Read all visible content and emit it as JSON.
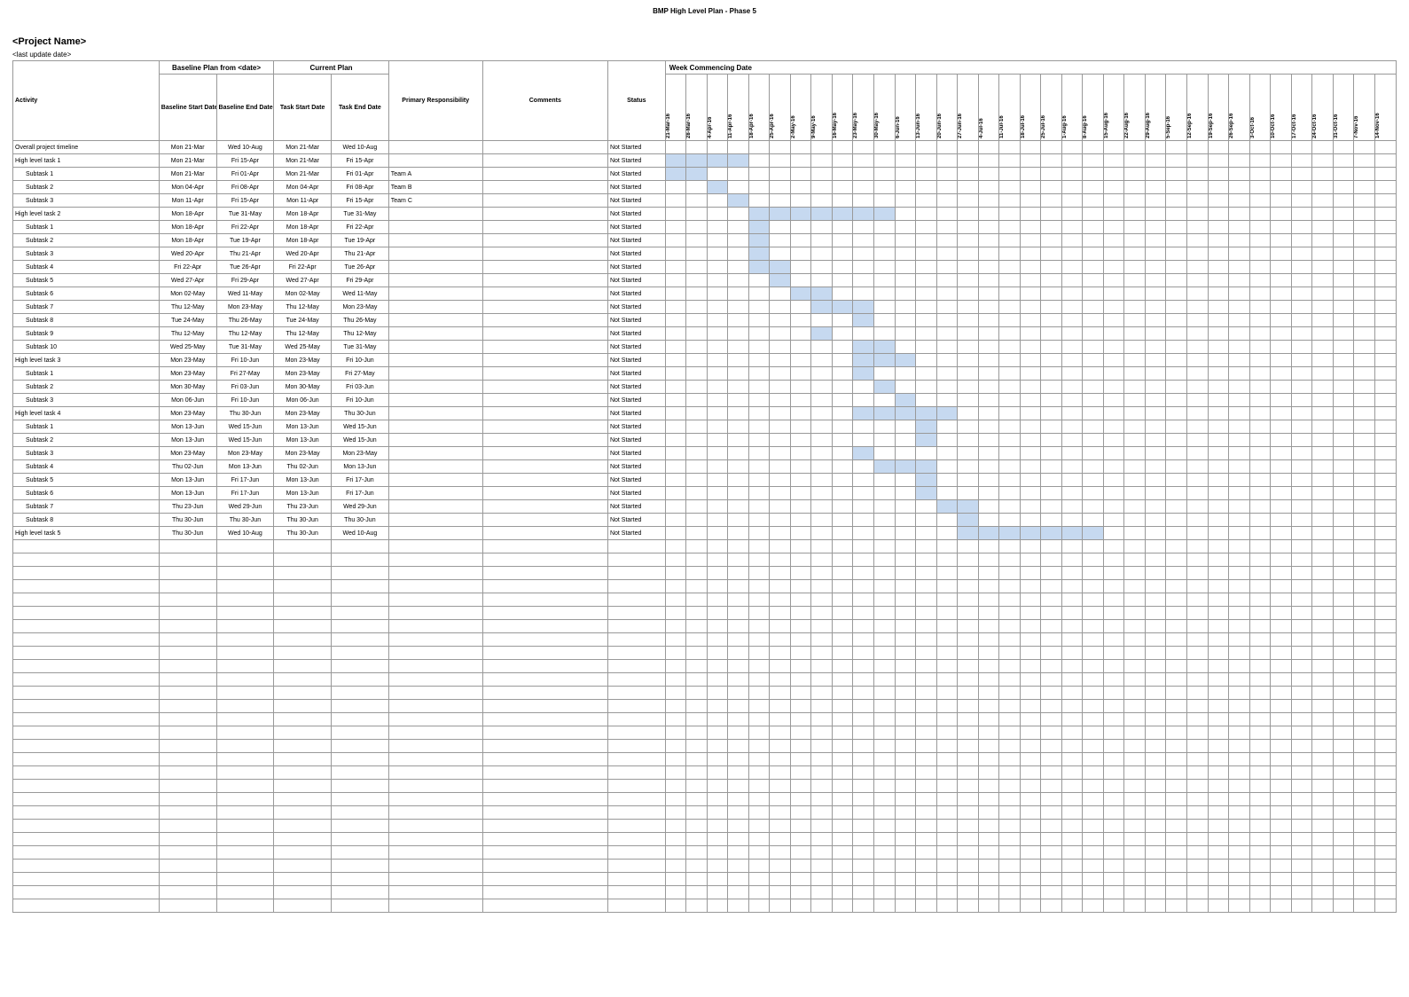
{
  "doc_title_top": "BMP High Level Plan - Phase 5",
  "project_name": "<Project Name>",
  "last_update": "<last update date>",
  "super_headers": {
    "baseline": "Baseline Plan\nfrom <date>",
    "current": "Current Plan",
    "weeks": "Week Commencing Date"
  },
  "headers": {
    "activity": "Activity",
    "bl_start": "Baseline Start Date",
    "bl_end": "Baseline End Date",
    "task_start": "Task Start Date",
    "task_end": "Task End Date",
    "resp": "Primary Responsibility",
    "comments": "Comments",
    "status": "Status"
  },
  "week_labels": [
    "21-Mar-16",
    "28-Mar-16",
    "4-Apr-16",
    "11-Apr-16",
    "18-Apr-16",
    "25-Apr-16",
    "2-May-16",
    "9-May-16",
    "16-May-16",
    "23-May-16",
    "30-May-16",
    "6-Jun-16",
    "13-Jun-16",
    "20-Jun-16",
    "27-Jun-16",
    "4-Jul-16",
    "11-Jul-16",
    "18-Jul-16",
    "25-Jul-16",
    "1-Aug-16",
    "8-Aug-16",
    "15-Aug-16",
    "22-Aug-16",
    "29-Aug-16",
    "5-Sep-16",
    "12-Sep-16",
    "19-Sep-16",
    "26-Sep-16",
    "3-Oct-16",
    "10-Oct-16",
    "17-Oct-16",
    "24-Oct-16",
    "31-Oct-16",
    "7-Nov-16",
    "14-Nov-16"
  ],
  "rows": [
    {
      "a": "Overall project timeline",
      "i": 0,
      "bs": "Mon 21-Mar",
      "be": "Wed 10-Aug",
      "ts": "Mon 21-Mar",
      "te": "Wed 10-Aug",
      "r": "",
      "s": "Not Started",
      "bar": []
    },
    {
      "a": "High level task 1",
      "i": 0,
      "bs": "Mon 21-Mar",
      "be": "Fri 15-Apr",
      "ts": "Mon 21-Mar",
      "te": "Fri 15-Apr",
      "r": "",
      "s": "Not Started",
      "bar": [
        0,
        1,
        2,
        3
      ]
    },
    {
      "a": "Subtask 1",
      "i": 2,
      "bs": "Mon 21-Mar",
      "be": "Fri 01-Apr",
      "ts": "Mon 21-Mar",
      "te": "Fri 01-Apr",
      "r": "Team A",
      "s": "Not Started",
      "bar": [
        0,
        1
      ]
    },
    {
      "a": "Subtask 2",
      "i": 2,
      "bs": "Mon 04-Apr",
      "be": "Fri 08-Apr",
      "ts": "Mon 04-Apr",
      "te": "Fri 08-Apr",
      "r": "Team B",
      "s": "Not Started",
      "bar": [
        2
      ]
    },
    {
      "a": "Subtask 3",
      "i": 2,
      "bs": "Mon 11-Apr",
      "be": "Fri 15-Apr",
      "ts": "Mon 11-Apr",
      "te": "Fri 15-Apr",
      "r": "Team C",
      "s": "Not Started",
      "bar": [
        3
      ]
    },
    {
      "a": "High level task 2",
      "i": 0,
      "bs": "Mon 18-Apr",
      "be": "Tue 31-May",
      "ts": "Mon 18-Apr",
      "te": "Tue 31-May",
      "r": "",
      "s": "Not Started",
      "bar": [
        4,
        5,
        6,
        7,
        8,
        9,
        10
      ]
    },
    {
      "a": "Subtask 1",
      "i": 2,
      "bs": "Mon 18-Apr",
      "be": "Fri 22-Apr",
      "ts": "Mon 18-Apr",
      "te": "Fri 22-Apr",
      "r": "",
      "s": "Not Started",
      "bar": [
        4
      ]
    },
    {
      "a": "Subtask 2",
      "i": 2,
      "bs": "Mon 18-Apr",
      "be": "Tue 19-Apr",
      "ts": "Mon 18-Apr",
      "te": "Tue 19-Apr",
      "r": "",
      "s": "Not Started",
      "bar": [
        4
      ]
    },
    {
      "a": "Subtask 3",
      "i": 2,
      "bs": "Wed 20-Apr",
      "be": "Thu 21-Apr",
      "ts": "Wed 20-Apr",
      "te": "Thu 21-Apr",
      "r": "",
      "s": "Not Started",
      "bar": [
        4
      ]
    },
    {
      "a": "Subtask 4",
      "i": 2,
      "bs": "Fri 22-Apr",
      "be": "Tue 26-Apr",
      "ts": "Fri 22-Apr",
      "te": "Tue 26-Apr",
      "r": "",
      "s": "Not Started",
      "bar": [
        4,
        5
      ]
    },
    {
      "a": "Subtask 5",
      "i": 2,
      "bs": "Wed 27-Apr",
      "be": "Fri 29-Apr",
      "ts": "Wed 27-Apr",
      "te": "Fri 29-Apr",
      "r": "",
      "s": "Not Started",
      "bar": [
        5
      ]
    },
    {
      "a": "Subtask 6",
      "i": 2,
      "bs": "Mon 02-May",
      "be": "Wed 11-May",
      "ts": "Mon 02-May",
      "te": "Wed 11-May",
      "r": "",
      "s": "Not Started",
      "bar": [
        6,
        7
      ]
    },
    {
      "a": "Subtask 7",
      "i": 2,
      "bs": "Thu 12-May",
      "be": "Mon 23-May",
      "ts": "Thu 12-May",
      "te": "Mon 23-May",
      "r": "",
      "s": "Not Started",
      "bar": [
        7,
        8,
        9
      ]
    },
    {
      "a": "Subtask 8",
      "i": 2,
      "bs": "Tue 24-May",
      "be": "Thu 26-May",
      "ts": "Tue 24-May",
      "te": "Thu 26-May",
      "r": "",
      "s": "Not Started",
      "bar": [
        9
      ]
    },
    {
      "a": "Subtask 9",
      "i": 2,
      "bs": "Thu 12-May",
      "be": "Thu 12-May",
      "ts": "Thu 12-May",
      "te": "Thu 12-May",
      "r": "",
      "s": "Not Started",
      "bar": [
        7
      ]
    },
    {
      "a": "Subtask 10",
      "i": 2,
      "bs": "Wed 25-May",
      "be": "Tue 31-May",
      "ts": "Wed 25-May",
      "te": "Tue 31-May",
      "r": "",
      "s": "Not Started",
      "bar": [
        9,
        10
      ]
    },
    {
      "a": "High level task 3",
      "i": 0,
      "bs": "Mon 23-May",
      "be": "Fri 10-Jun",
      "ts": "Mon 23-May",
      "te": "Fri 10-Jun",
      "r": "",
      "s": "Not Started",
      "bar": [
        9,
        10,
        11
      ]
    },
    {
      "a": "Subtask 1",
      "i": 2,
      "bs": "Mon 23-May",
      "be": "Fri 27-May",
      "ts": "Mon 23-May",
      "te": "Fri 27-May",
      "r": "",
      "s": "Not Started",
      "bar": [
        9
      ]
    },
    {
      "a": "Subtask 2",
      "i": 2,
      "bs": "Mon 30-May",
      "be": "Fri 03-Jun",
      "ts": "Mon 30-May",
      "te": "Fri 03-Jun",
      "r": "",
      "s": "Not Started",
      "bar": [
        10
      ]
    },
    {
      "a": "Subtask 3",
      "i": 2,
      "bs": "Mon 06-Jun",
      "be": "Fri 10-Jun",
      "ts": "Mon 06-Jun",
      "te": "Fri 10-Jun",
      "r": "",
      "s": "Not Started",
      "bar": [
        11
      ]
    },
    {
      "a": "High level task 4",
      "i": 0,
      "bs": "Mon 23-May",
      "be": "Thu 30-Jun",
      "ts": "Mon 23-May",
      "te": "Thu 30-Jun",
      "r": "",
      "s": "Not Started",
      "bar": [
        9,
        10,
        11,
        12,
        13
      ]
    },
    {
      "a": "Subtask 1",
      "i": 2,
      "bs": "Mon 13-Jun",
      "be": "Wed 15-Jun",
      "ts": "Mon 13-Jun",
      "te": "Wed 15-Jun",
      "r": "",
      "s": "Not Started",
      "bar": [
        12
      ]
    },
    {
      "a": "Subtask 2",
      "i": 2,
      "bs": "Mon 13-Jun",
      "be": "Wed 15-Jun",
      "ts": "Mon 13-Jun",
      "te": "Wed 15-Jun",
      "r": "",
      "s": "Not Started",
      "bar": [
        12
      ]
    },
    {
      "a": "Subtask 3",
      "i": 2,
      "bs": "Mon 23-May",
      "be": "Mon 23-May",
      "ts": "Mon 23-May",
      "te": "Mon 23-May",
      "r": "",
      "s": "Not Started",
      "bar": [
        9
      ]
    },
    {
      "a": "Subtask 4",
      "i": 2,
      "bs": "Thu 02-Jun",
      "be": "Mon 13-Jun",
      "ts": "Thu 02-Jun",
      "te": "Mon 13-Jun",
      "r": "",
      "s": "Not Started",
      "bar": [
        10,
        11,
        12
      ]
    },
    {
      "a": "Subtask 5",
      "i": 2,
      "bs": "Mon 13-Jun",
      "be": "Fri 17-Jun",
      "ts": "Mon 13-Jun",
      "te": "Fri 17-Jun",
      "r": "",
      "s": "Not Started",
      "bar": [
        12
      ]
    },
    {
      "a": "Subtask 6",
      "i": 2,
      "bs": "Mon 13-Jun",
      "be": "Fri 17-Jun",
      "ts": "Mon 13-Jun",
      "te": "Fri 17-Jun",
      "r": "",
      "s": "Not Started",
      "bar": [
        12
      ]
    },
    {
      "a": "Subtask 7",
      "i": 2,
      "bs": "Thu 23-Jun",
      "be": "Wed 29-Jun",
      "ts": "Thu 23-Jun",
      "te": "Wed 29-Jun",
      "r": "",
      "s": "Not Started",
      "bar": [
        13,
        14
      ]
    },
    {
      "a": "Subtask 8",
      "i": 2,
      "bs": "Thu 30-Jun",
      "be": "Thu 30-Jun",
      "ts": "Thu 30-Jun",
      "te": "Thu 30-Jun",
      "r": "",
      "s": "Not Started",
      "bar": [
        14
      ]
    },
    {
      "a": "High level task 5",
      "i": 0,
      "bs": "Thu 30-Jun",
      "be": "Wed 10-Aug",
      "ts": "Thu 30-Jun",
      "te": "Wed 10-Aug",
      "r": "",
      "s": "Not Started",
      "bar": [
        14,
        15,
        16,
        17,
        18,
        19,
        20
      ]
    }
  ],
  "empty_rows": 28
}
